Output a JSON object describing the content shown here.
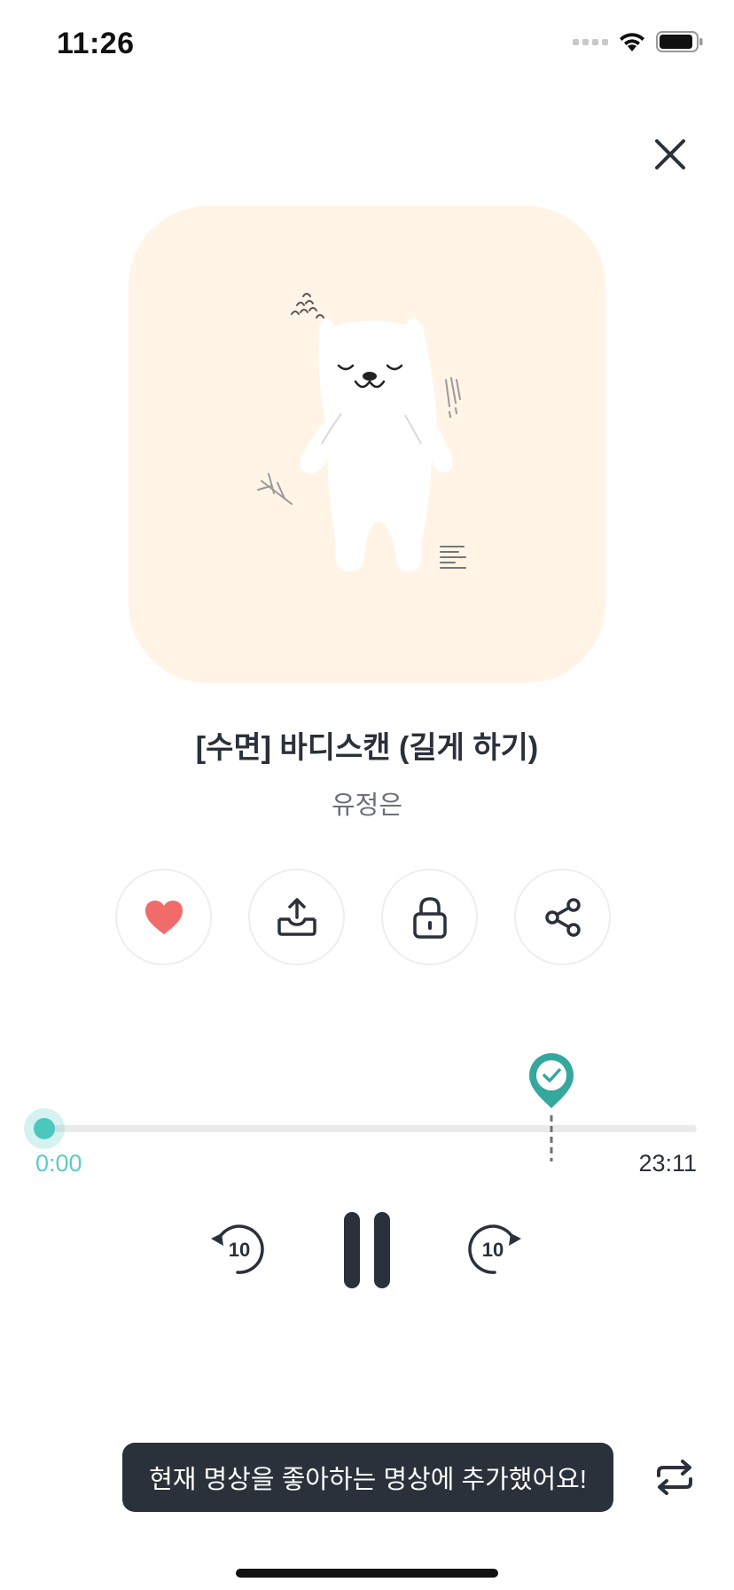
{
  "status_bar": {
    "time": "11:26"
  },
  "header": {
    "close_icon": "close-icon"
  },
  "track": {
    "title": "[수면] 바디스캔 (길게 하기)",
    "artist": "유정은",
    "artwork": "sleeping-bear-illustration"
  },
  "actions": [
    {
      "name": "like",
      "icon": "heart-icon",
      "active": true
    },
    {
      "name": "download",
      "icon": "download-tray-icon"
    },
    {
      "name": "lock",
      "icon": "lock-icon"
    },
    {
      "name": "share",
      "icon": "share-icon"
    }
  ],
  "progress": {
    "current": "0:00",
    "total": "23:11",
    "position_fraction": 0.0,
    "marker_fraction": 0.78
  },
  "controls": {
    "rewind_seconds": "10",
    "forward_seconds": "10",
    "state": "playing"
  },
  "toast": {
    "message": "현재 명상을 좋아하는 명상에 추가했어요!"
  },
  "colors": {
    "accent": "#5ccdc4",
    "marker": "#35a89e",
    "heart": "#f26b6b",
    "artwork_bg": "#fff4e6",
    "toast_bg": "#2b313b"
  }
}
